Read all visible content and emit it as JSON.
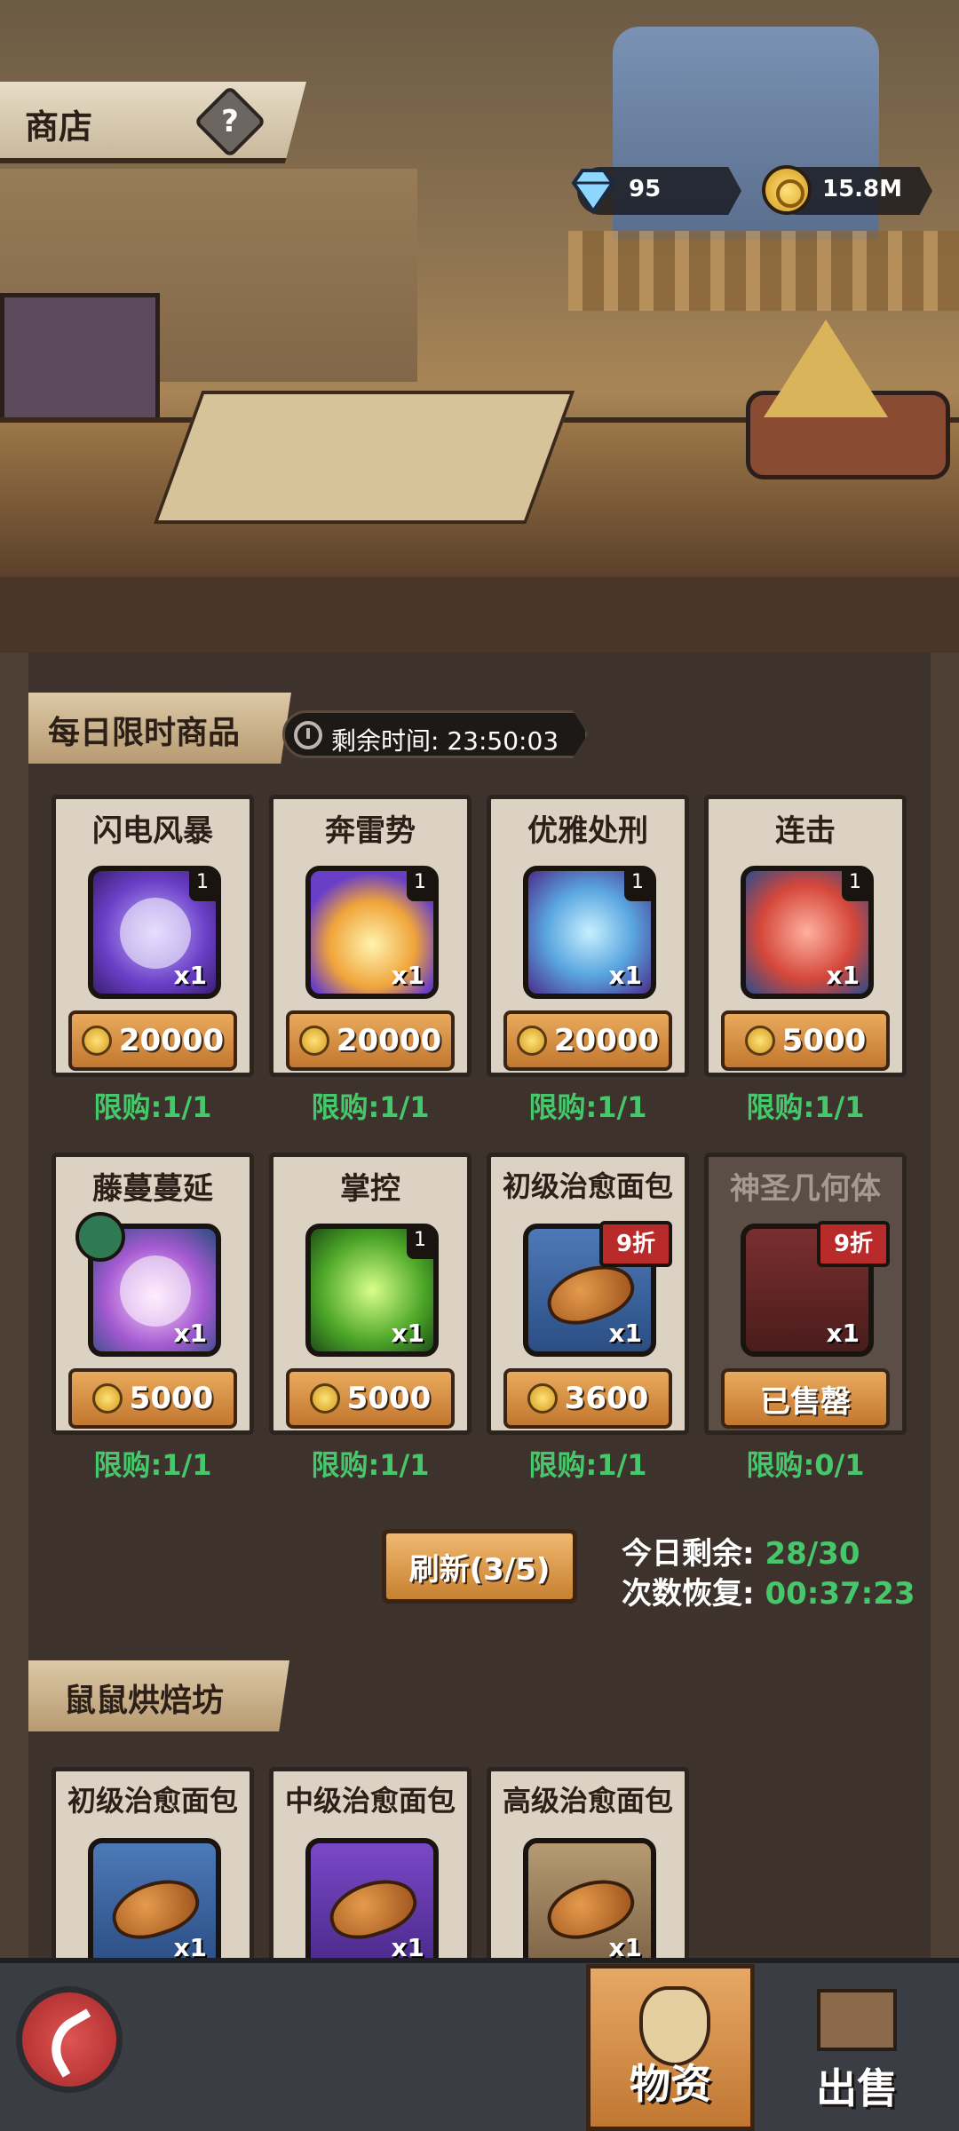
{
  "header": {
    "title": "商店",
    "help_icon": "?"
  },
  "currency": {
    "gems": "95",
    "gold": "15.8M"
  },
  "daily": {
    "section_title": "每日限时商品",
    "timer_text": "剩余时间: 23:50:03",
    "items": [
      {
        "name": "闪电风暴",
        "qty": "x1",
        "level": "1",
        "price": "20000",
        "limit": "限购:1/1"
      },
      {
        "name": "奔雷势",
        "qty": "x1",
        "level": "1",
        "price": "20000",
        "limit": "限购:1/1"
      },
      {
        "name": "优雅处刑",
        "qty": "x1",
        "level": "1",
        "price": "20000",
        "limit": "限购:1/1"
      },
      {
        "name": "连击",
        "qty": "x1",
        "level": "1",
        "price": "5000",
        "limit": "限购:1/1"
      },
      {
        "name": "藤蔓蔓延",
        "qty": "x1",
        "price": "5000",
        "limit": "限购:1/1"
      },
      {
        "name": "掌控",
        "qty": "x1",
        "level": "1",
        "price": "5000",
        "limit": "限购:1/1"
      },
      {
        "name": "初级治愈面包",
        "qty": "x1",
        "discount": "9折",
        "price": "3600",
        "limit": "限购:1/1"
      },
      {
        "name": "神圣几何体",
        "qty": "x1",
        "discount": "9折",
        "price": "已售罄",
        "limit": "限购:0/1"
      }
    ],
    "refresh_label": "刷新(3/5)",
    "today_remaining_label": "今日剩余:",
    "today_remaining_value": "28/30",
    "recover_label": "次数恢复:",
    "recover_value": "00:37:23"
  },
  "bakery": {
    "section_title": "鼠鼠烘焙坊",
    "items": [
      {
        "name": "初级治愈面包",
        "qty": "x1"
      },
      {
        "name": "中级治愈面包",
        "qty": "x1"
      },
      {
        "name": "高级治愈面包",
        "qty": "x1"
      }
    ]
  },
  "bottom_tabs": {
    "supplies": "物资",
    "sell": "出售"
  }
}
